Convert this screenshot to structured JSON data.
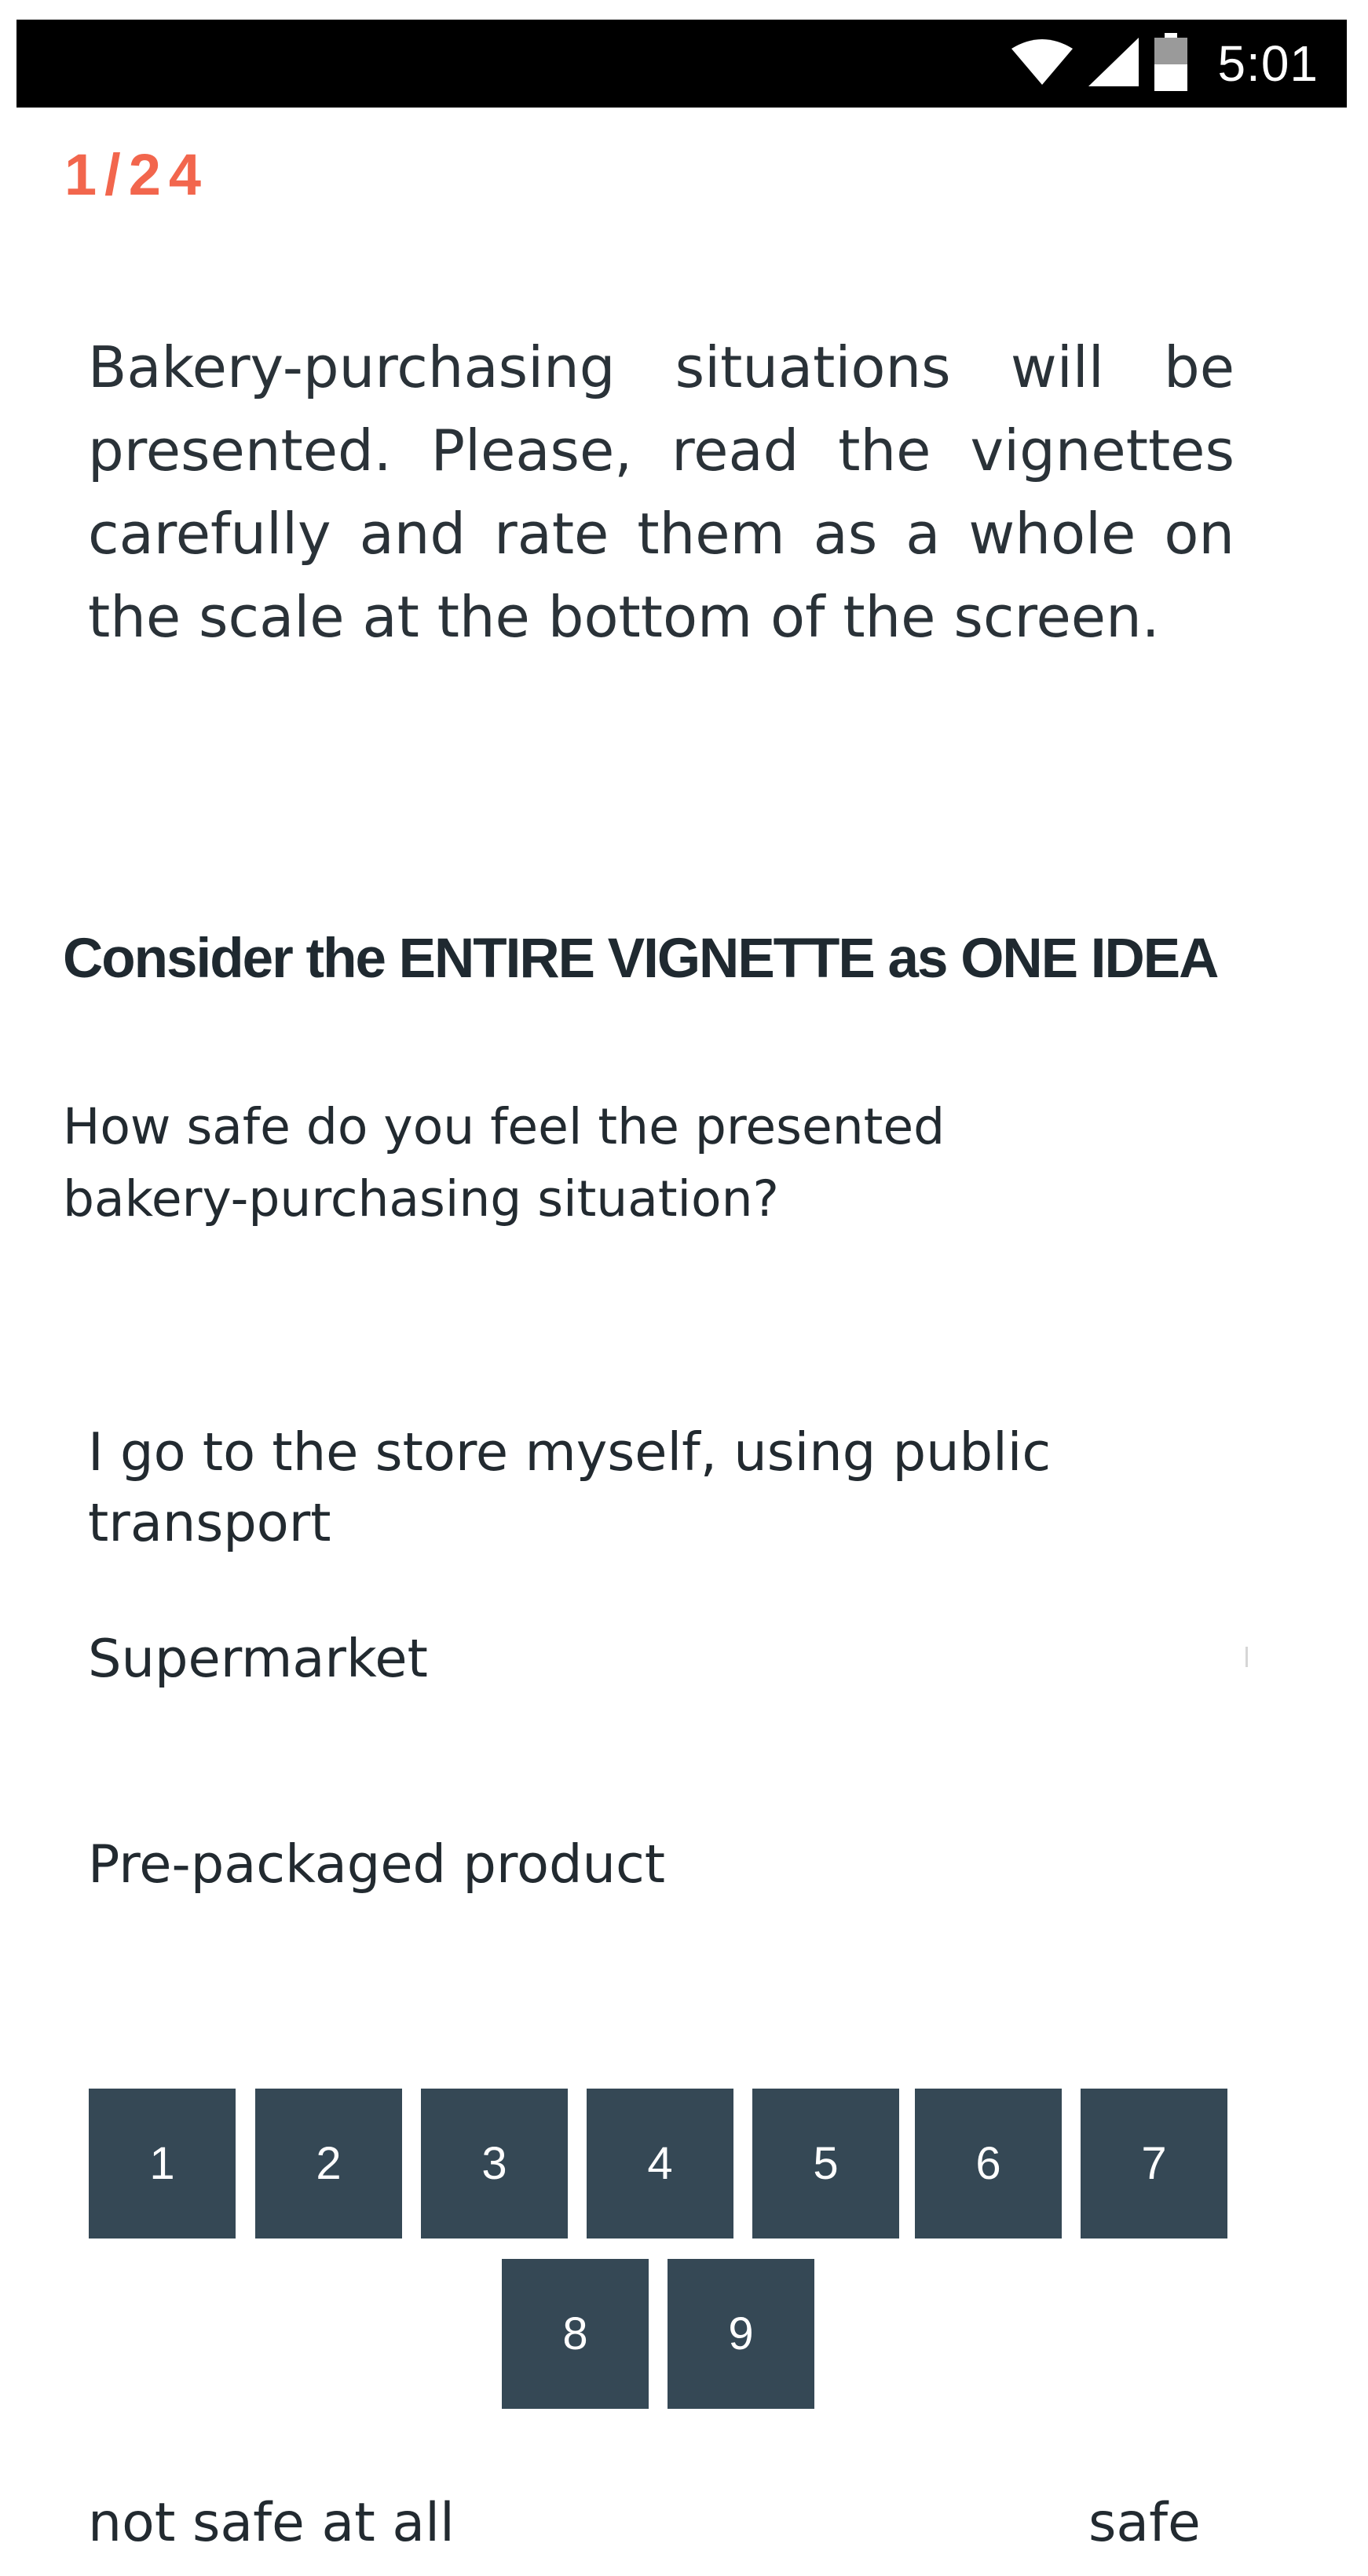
{
  "status_bar": {
    "time": "5:01",
    "icons": [
      "wifi-icon",
      "signal-icon",
      "battery-icon"
    ]
  },
  "progress": {
    "counter": "1/24"
  },
  "instructions": "Bakery-purchasing situations will be presented. Please, read the vignettes carefully and rate them as a whole on the scale at the bottom of the screen.",
  "section": {
    "title": "Consider the ENTIRE VIGNETTE as ONE IDEA",
    "question": "How safe do you feel the presented bakery-purchasing situation?"
  },
  "vignette": {
    "items": [
      "I go to the store myself, using public transport",
      "Supermarket",
      "Pre-packaged product"
    ]
  },
  "rating": {
    "options": [
      "1",
      "2",
      "3",
      "4",
      "5",
      "6",
      "7",
      "8",
      "9"
    ],
    "label_low": "not safe at all",
    "label_high": "safe"
  },
  "colors": {
    "accent": "#f2664d",
    "button": "#354855",
    "status_bar": "#000000"
  }
}
